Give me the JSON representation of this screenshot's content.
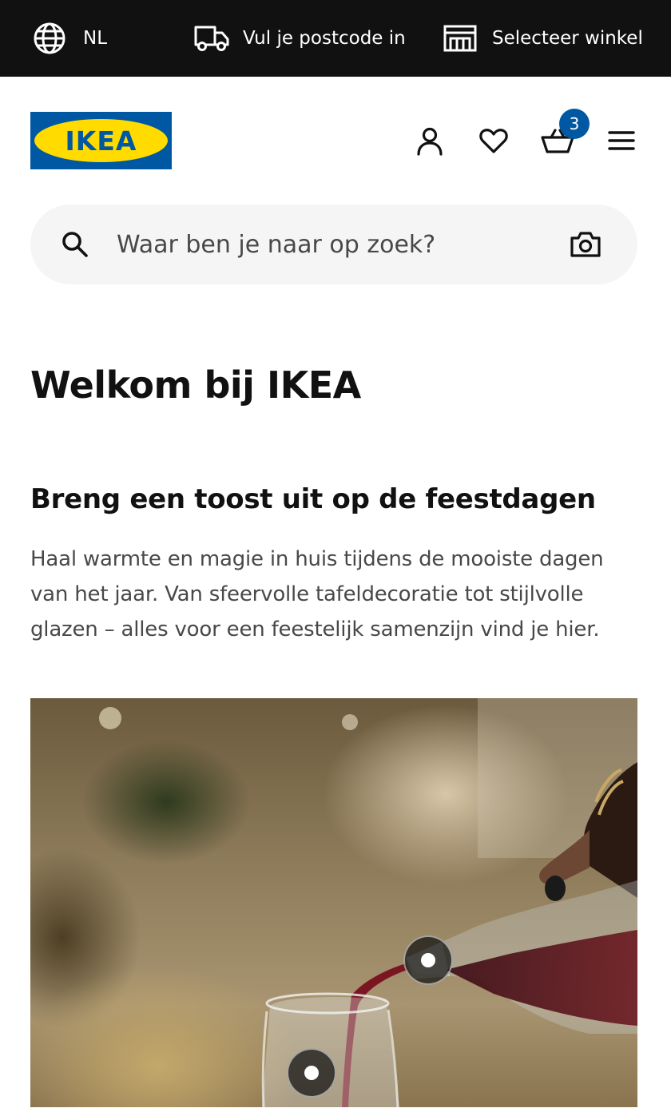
{
  "topbar": {
    "language_label": "NL",
    "postcode_label": "Vul je postcode in",
    "store_label": "Selecteer winkel"
  },
  "header": {
    "logo_text": "IKEA",
    "cart_count": "3",
    "icons": [
      "account-icon",
      "heart-icon",
      "shopping-cart-icon",
      "hamburger-menu-icon"
    ]
  },
  "search": {
    "placeholder": "Waar ben je naar op zoek?",
    "value": ""
  },
  "main": {
    "welcome_title": "Welkom bij IKEA",
    "promo": {
      "title": "Breng een toost uit op de feestdagen",
      "body": "Haal warmte en magie in huis tijdens de mooiste dagen van het jaar. Van sfeervolle tafeldecoratie tot stijlvolle glazen – alles voor een feestelijk samenzijn vind je hier."
    }
  },
  "colors": {
    "topbar_bg": "#111111",
    "brand_blue": "#0058a3",
    "brand_yellow": "#ffdb00",
    "search_bg": "#f5f5f5",
    "body_text": "#484848"
  }
}
